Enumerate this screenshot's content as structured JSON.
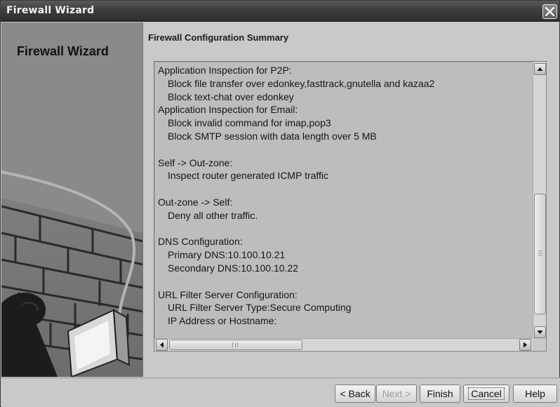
{
  "window": {
    "title": "Firewall Wizard"
  },
  "banner": {
    "title": "Firewall Wizard"
  },
  "content": {
    "section_title": "Firewall Configuration Summary",
    "summary_lines": [
      {
        "text": "Application Inspection for P2P:",
        "indent": false
      },
      {
        "text": "Block file transfer over edonkey,fasttrack,gnutella and kazaa2",
        "indent": true
      },
      {
        "text": "Block text-chat over edonkey",
        "indent": true
      },
      {
        "text": "Application Inspection for Email:",
        "indent": false
      },
      {
        "text": "Block invalid command for imap,pop3",
        "indent": true
      },
      {
        "text": "Block SMTP session with data length over 5 MB",
        "indent": true
      },
      {
        "text": "",
        "indent": false
      },
      {
        "text": "Self -> Out-zone:",
        "indent": false
      },
      {
        "text": "Inspect router generated ICMP traffic",
        "indent": true
      },
      {
        "text": "",
        "indent": false
      },
      {
        "text": "Out-zone -> Self:",
        "indent": false
      },
      {
        "text": "Deny all other traffic.",
        "indent": true
      },
      {
        "text": "",
        "indent": false
      },
      {
        "text": "DNS Configuration:",
        "indent": false
      },
      {
        "text": "Primary DNS:10.100.10.21",
        "indent": true
      },
      {
        "text": "Secondary DNS:10.100.10.22",
        "indent": true
      },
      {
        "text": "",
        "indent": false
      },
      {
        "text": "URL Filter Server Configuration:",
        "indent": false
      },
      {
        "text": "URL Filter Server Type:Secure Computing",
        "indent": true
      },
      {
        "text": "IP Address or Hostname:",
        "indent": true
      }
    ],
    "vertical_scroll_position": 0.47
  },
  "buttons": {
    "back": "< Back",
    "next": "Next >",
    "finish": "Finish",
    "cancel": "Cancel",
    "help": "Help"
  },
  "icons": {
    "close": "close-icon",
    "scroll_up": "arrow-up-icon",
    "scroll_down": "arrow-down-icon",
    "scroll_left": "arrow-left-icon",
    "scroll_right": "arrow-right-icon"
  },
  "colors": {
    "titlebar": "#3e3e3e",
    "window_bg": "#c9c9c9",
    "text_area_bg": "#bdbdbd"
  }
}
